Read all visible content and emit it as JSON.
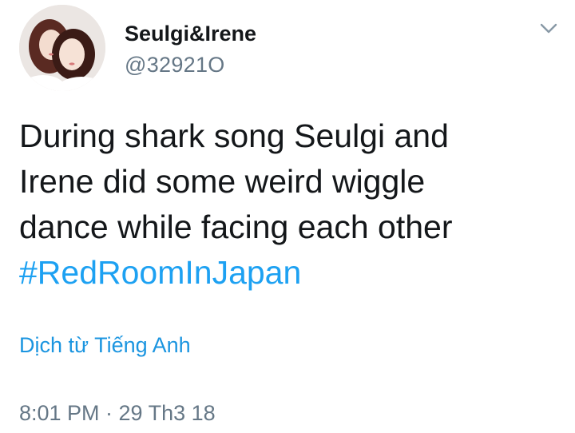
{
  "author": {
    "display_name": "Seulgi&Irene",
    "handle": "@32921O",
    "avatar_icon": "profile-photo"
  },
  "menu": {
    "icon": "chevron-down-icon"
  },
  "tweet": {
    "lines": [
      "During shark song Seulgi and",
      "Irene did some weird wiggle",
      "dance while facing each other"
    ],
    "hashtag": "#RedRoomInJapan"
  },
  "translate": {
    "label": "Dịch từ Tiếng Anh"
  },
  "meta": {
    "timestamp": "8:01 PM · 29 Th3 18"
  },
  "colors": {
    "text": "#14171a",
    "secondary": "#657786",
    "link": "#1da1f2",
    "background": "#ffffff"
  }
}
